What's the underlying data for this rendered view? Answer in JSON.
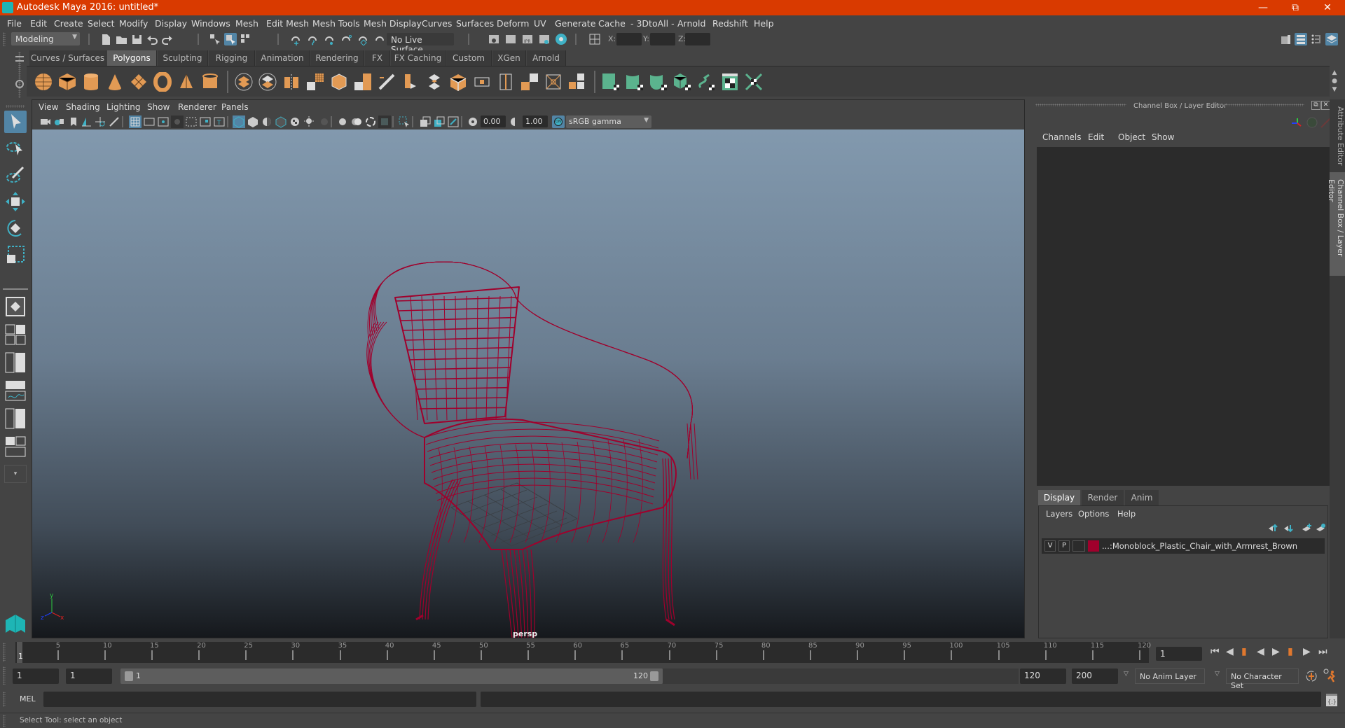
{
  "window": {
    "title": "Autodesk Maya 2016: untitled*",
    "controls": [
      "minimize-icon",
      "restore-icon",
      "close-icon"
    ]
  },
  "menubar": [
    "File",
    "Edit",
    "Create",
    "Select",
    "Modify",
    "Display",
    "Windows",
    "Mesh",
    "Edit Mesh",
    "Mesh Tools",
    "Mesh Display",
    "Curves",
    "Surfaces",
    "Deform",
    "UV",
    "Generate",
    "Cache",
    "- 3DtoAll -",
    "Arnold",
    "Redshift",
    "Help"
  ],
  "statusline": {
    "mode": "Modeling",
    "live_surface": "No Live Surface",
    "x_label": "X:",
    "y_label": "Y:",
    "z_label": "Z:",
    "x_value": "",
    "y_value": "",
    "z_value": ""
  },
  "shelf": {
    "tabs": [
      "Curves / Surfaces",
      "Polygons",
      "Sculpting",
      "Rigging",
      "Animation",
      "Rendering",
      "FX",
      "FX Caching",
      "Custom",
      "XGen",
      "Arnold"
    ],
    "active_tab": "Polygons",
    "icons": [
      "poly-sphere-icon",
      "poly-cube-icon",
      "poly-cylinder-icon",
      "poly-cone-icon",
      "poly-plane-icon",
      "poly-torus-icon",
      "poly-pyramid-icon",
      "poly-pipe-icon",
      "combine-icon",
      "separate-icon",
      "mirror-icon",
      "smooth-icon",
      "extrude-icon",
      "bridge-icon",
      "bevel-icon",
      "multi-cut-icon",
      "target-weld-icon",
      "append-icon",
      "fill-hole-icon",
      "insert-edge-loop-icon",
      "offset-edge-loop-icon",
      "slide-edge-icon",
      "merge-icon",
      "planar-uv-icon",
      "cylindrical-uv-icon",
      "spherical-uv-icon",
      "automatic-uv-icon",
      "contour-uv-icon",
      "uv-editor-icon",
      "unfold-uv-icon"
    ]
  },
  "viewport": {
    "menus": [
      "View",
      "Shading",
      "Lighting",
      "Show",
      "Renderer",
      "Panels"
    ],
    "exposure": "0.00",
    "gamma": "1.00",
    "color_mgmt": "ON",
    "color_space": "sRGB gamma",
    "camera_label": "persp",
    "axis_labels": {
      "x": "x",
      "y": "y",
      "z": "z"
    },
    "wire_color": "#a0002c"
  },
  "channel_box": {
    "title": "Channel Box / Layer Editor",
    "menus": [
      "Channels",
      "Edit",
      "Object",
      "Show"
    ]
  },
  "layer_editor": {
    "tabs": [
      "Display",
      "Render",
      "Anim"
    ],
    "active_tab": "Display",
    "menus": [
      "Layers",
      "Options",
      "Help"
    ],
    "layers": [
      {
        "v": "V",
        "p": "P",
        "color": "#a0002c",
        "name": "...:Monoblock_Plastic_Chair_with_Armrest_Brown"
      }
    ]
  },
  "side_tabs": [
    "Attribute Editor",
    "Channel Box / Layer Editor"
  ],
  "timeline": {
    "start": 1,
    "end": 120,
    "current": 1,
    "tick_labels": [
      5,
      10,
      15,
      20,
      25,
      30,
      35,
      40,
      45,
      50,
      55,
      60,
      65,
      70,
      75,
      80,
      85,
      90,
      95,
      100,
      105,
      110,
      115,
      120
    ],
    "current_frame_field": "1"
  },
  "range": {
    "start_time": "1",
    "playback_start": "1",
    "slider_start": "1",
    "slider_end": "120",
    "playback_end": "120",
    "end_time": "200",
    "anim_layer": "No Anim Layer",
    "character_set": "No Character Set"
  },
  "command": {
    "lang": "MEL",
    "input": "",
    "output": ""
  },
  "help_line": "Select Tool: select an object"
}
